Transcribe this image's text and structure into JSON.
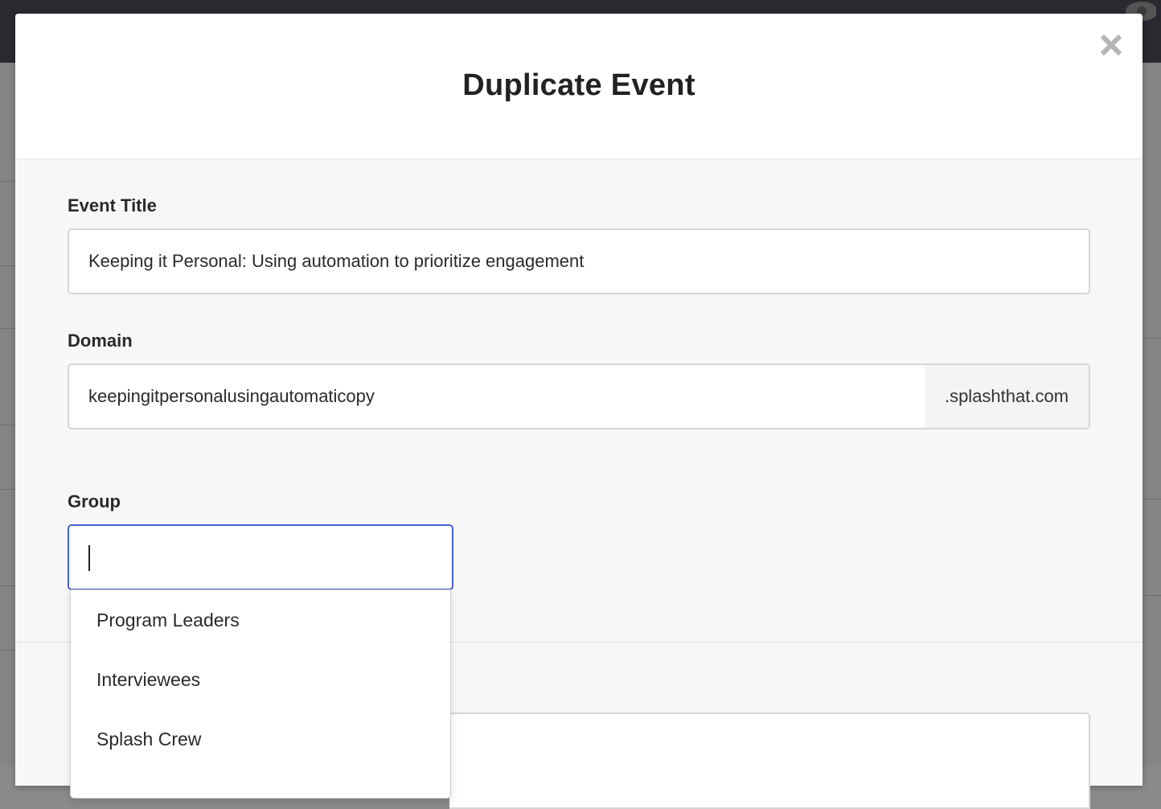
{
  "modal": {
    "title": "Duplicate Event",
    "close_icon": "close-icon"
  },
  "form": {
    "event_title": {
      "label": "Event Title",
      "value": "Keeping it Personal: Using automation to prioritize engagement"
    },
    "domain": {
      "label": "Domain",
      "value": "keepingitpersonalusingautomaticopy",
      "suffix": ".splashthat.com"
    },
    "group": {
      "label": "Group",
      "value": "",
      "options": [
        "Program Leaders",
        "Interviewees",
        "Splash Crew"
      ]
    }
  },
  "colors": {
    "focus_border": "#4a5fd0",
    "overlay_topbar": "#2c2830"
  }
}
